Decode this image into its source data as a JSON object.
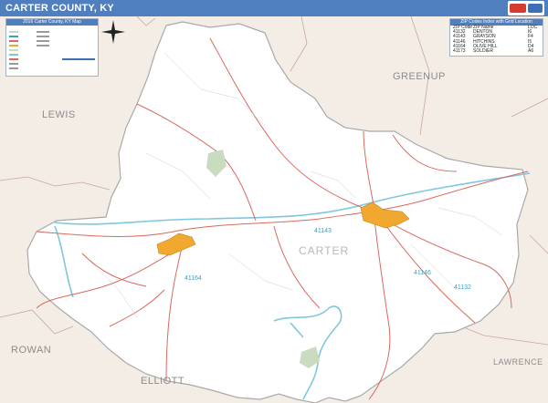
{
  "header": {
    "title": "CARTER COUNTY, KY"
  },
  "legend": {
    "title": "2016 Carter County, KY Map"
  },
  "map": {
    "main_label": "CARTER",
    "neighbors": [
      "LEWIS",
      "GREENUP",
      "ROWAN",
      "ELLIOTT",
      "LAWRENCE"
    ],
    "zip_labels": [
      "41143",
      "41164",
      "41146",
      "41132"
    ],
    "colors": {
      "county_fill": "#ffffff",
      "outside_fill": "#f3ede6",
      "roads": "#d9695f",
      "water": "#7fc7de",
      "city": "#f0a830",
      "border": "#a9a9a9"
    }
  },
  "zip_table": {
    "title": "ZIP Codes Index with Grid Location",
    "columns": [
      "ZIP Code",
      "ZIP Name",
      "LOC"
    ],
    "rows": [
      [
        "41132",
        "DENTON",
        "I6"
      ],
      [
        "41143",
        "GRAYSON",
        "F4"
      ],
      [
        "41146",
        "HITCHINS",
        "I5"
      ],
      [
        "41164",
        "OLIVE HILL",
        "D4"
      ],
      [
        "41173",
        "SOLDIER",
        "A6"
      ]
    ]
  }
}
